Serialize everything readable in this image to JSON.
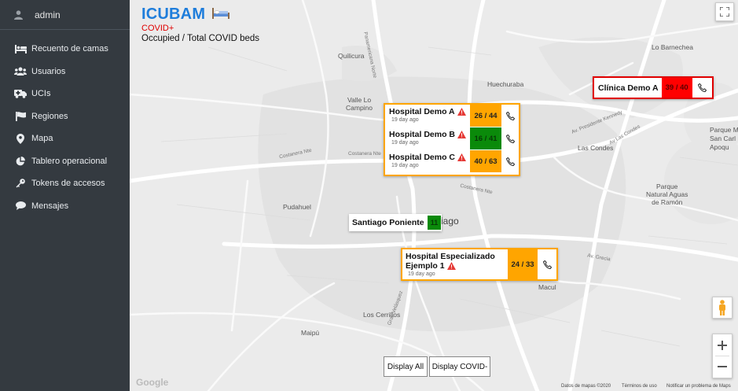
{
  "sidebar": {
    "user": "admin",
    "items": [
      {
        "label": "Recuento de camas",
        "icon": "bed-icon"
      },
      {
        "label": "Usuarios",
        "icon": "users-icon"
      },
      {
        "label": "UCIs",
        "icon": "ambulance-icon"
      },
      {
        "label": "Regiones",
        "icon": "flag-icon"
      },
      {
        "label": "Mapa",
        "icon": "map-marker-icon"
      },
      {
        "label": "Tablero operacional",
        "icon": "pie-chart-icon"
      },
      {
        "label": "Tokens de accesos",
        "icon": "key-icon"
      },
      {
        "label": "Mensajes",
        "icon": "comment-icon"
      }
    ]
  },
  "header": {
    "brand": "ICUBAM",
    "filter": "COVID+",
    "legend": "Occupied / Total COVID beds"
  },
  "places": {
    "quilicura": "Quilicura",
    "huechuraba": "Huechuraba",
    "valle_lo_campino_1": "Valle Lo",
    "valle_lo_campino_2": "Campino",
    "lo_barnechea": "Lo Barnechea",
    "las_condes": "Las Condes",
    "parque_mahuida_1": "Parque M",
    "parque_mahuida_2": "San Carl",
    "parque_mahuida_3": "Apoqu",
    "parque_natural_1": "Parque",
    "parque_natural_2": "Natural Aguas",
    "parque_natural_3": "de Ramón",
    "pudahuel": "Pudahuel",
    "santiago_suffix": "iago",
    "macul": "Macul",
    "los_cerrillos": "Los Cerrillos",
    "maipu": "Maipú"
  },
  "roads": {
    "panamericana": "Panamericana Norte",
    "costanera1": "Costanera Nte",
    "costanera2": "Costanera Nte",
    "costanera3": "Costanera Nte",
    "kennedy": "Av. Presidente Kennedy",
    "condes": "Av Las Condes",
    "grecia": "Av. Grecia",
    "vespucio": "Gral. Velásquez"
  },
  "markers": {
    "clinica": {
      "name": "Clínica Demo A",
      "count": "39 / 40",
      "color": "#ff0000"
    },
    "group": [
      {
        "name": "Hospital Demo A",
        "time": "19 day ago",
        "count": "26 / 44",
        "color": "#ffa500"
      },
      {
        "name": "Hospital Demo B",
        "time": "19 day ago",
        "count": "16 / 41",
        "color": "#008000"
      },
      {
        "name": "Hospital Demo C",
        "time": "19 day ago",
        "count": "40 / 63",
        "color": "#ffa500"
      }
    ],
    "poniente": {
      "name": "Santiago Poniente",
      "count": "11",
      "color": "#008000"
    },
    "especializado": {
      "name1": "Hospital Especializado",
      "name2": "Ejemplo 1",
      "time": "19 day ago",
      "count": "24 / 33",
      "color": "#ffa500"
    }
  },
  "buttons": {
    "display_all": "Display All",
    "display_covid": "Display COVID-"
  },
  "footer": {
    "google": "Google",
    "map_data": "Datos de mapas ©2020",
    "terms": "Términos de uso",
    "report": "Notificar un problema de Maps"
  }
}
